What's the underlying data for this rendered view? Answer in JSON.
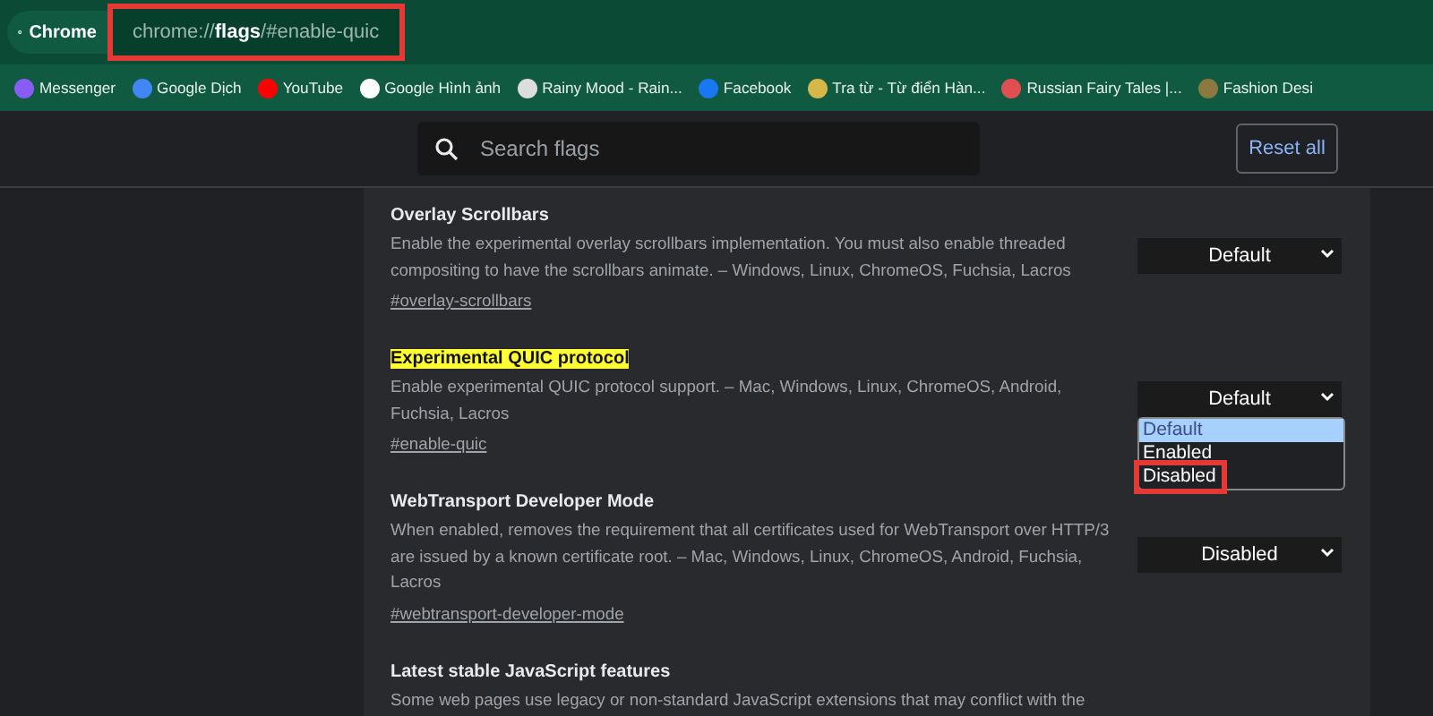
{
  "tab": {
    "label": "Chrome"
  },
  "address": {
    "value": "chrome://**flags**/#enable-quic",
    "highlighted": true
  },
  "bookmarks": [
    {
      "label": "Messenger",
      "color": "#8a5cf6"
    },
    {
      "label": "Google Dịch",
      "color": "#4285f4"
    },
    {
      "label": "YouTube",
      "color": "#ff0000"
    },
    {
      "label": "Google Hình ảnh",
      "color": "#ffffff"
    },
    {
      "label": "Rainy Mood - Rain...",
      "color": "#dddddd"
    },
    {
      "label": "Facebook",
      "color": "#1877f2"
    },
    {
      "label": "Tra từ - Từ điển Hàn...",
      "color": "#d6b84a"
    },
    {
      "label": "Russian Fairy Tales |...",
      "color": "#e05050"
    },
    {
      "label": "Fashion Desi",
      "color": "#8a7a40"
    }
  ],
  "search": {
    "placeholder": "Search flags"
  },
  "reset_button": "Reset all",
  "flags": [
    {
      "title": "Overlay Scrollbars",
      "highlighted": false,
      "description": "Enable the experimental overlay scrollbars implementation. You must also enable threaded compositing to have the scrollbars animate. – Windows, Linux, ChromeOS, Fuchsia, Lacros",
      "link": "#overlay-scrollbars",
      "select": {
        "value": "Default"
      }
    },
    {
      "title": "Experimental QUIC protocol",
      "highlighted": true,
      "description": "Enable experimental QUIC protocol support. – Mac, Windows, Linux, ChromeOS, Android, Fuchsia, Lacros",
      "link": "#enable-quic",
      "select": {
        "value": "Default",
        "open": true,
        "options": [
          {
            "label": "Default",
            "selected": true,
            "marked": false
          },
          {
            "label": "Enabled",
            "selected": false,
            "marked": false
          },
          {
            "label": "Disabled",
            "selected": false,
            "marked": true
          }
        ]
      }
    },
    {
      "title": "WebTransport Developer Mode",
      "highlighted": false,
      "description": "When enabled, removes the requirement that all certificates used for WebTransport over HTTP/3 are issued by a known certificate root. – Mac, Windows, Linux, ChromeOS, Android, Fuchsia, Lacros",
      "link": "#webtransport-developer-mode",
      "select": {
        "value": "Disabled"
      }
    },
    {
      "title": "Latest stable JavaScript features",
      "highlighted": false,
      "description": "Some web pages use legacy or non-standard JavaScript extensions that may conflict with the"
    }
  ]
}
